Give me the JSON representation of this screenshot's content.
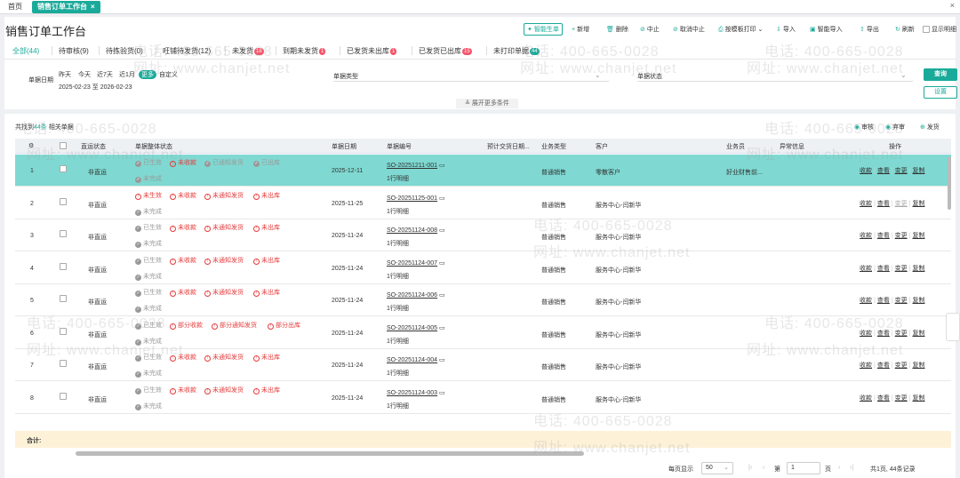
{
  "topbar": {
    "home_tab": "首页",
    "active_tab": "销售订单工作台",
    "close": "×",
    "close_window": "×"
  },
  "header": {
    "title": "销售订单工作台",
    "toolbar": [
      {
        "label": "智能生单",
        "icon": "sparkle-icon"
      },
      {
        "label": "新增",
        "icon": "plus-icon"
      },
      {
        "label": "删除",
        "icon": "trash-icon"
      },
      {
        "label": "中止",
        "icon": "stop-icon"
      },
      {
        "label": "取消中止",
        "icon": "undo-icon"
      },
      {
        "label": "按模板打印",
        "icon": "print-icon"
      },
      {
        "label": "导入",
        "icon": "import-icon"
      },
      {
        "label": "智能导入",
        "icon": "smart-import-icon"
      },
      {
        "label": "导出",
        "icon": "export-icon"
      },
      {
        "label": "刷新",
        "icon": "refresh-icon"
      }
    ],
    "show_detail": "显示明细"
  },
  "tabs": [
    {
      "label": "全部(44)",
      "badge": ""
    },
    {
      "label": "待审核(9)",
      "badge": ""
    },
    {
      "label": "待拣验货(0)",
      "badge": ""
    },
    {
      "label": "旺铺待发货(12)",
      "badge": ""
    },
    {
      "label": "未发货",
      "badge": "18"
    },
    {
      "label": "到期未发货",
      "badge": "1"
    },
    {
      "label": "已发货未出库",
      "badge": "1"
    },
    {
      "label": "已发货已出库",
      "badge": "15"
    },
    {
      "label": "未打印单据",
      "badge": "44"
    }
  ],
  "filters": {
    "date_label": "单据日期",
    "quick_dates": [
      "昨天",
      "今天",
      "近7天",
      "近1月",
      "更多",
      "自定义"
    ],
    "date_range": "2025-02-23 至 2026-02-23",
    "type_label": "单据类型",
    "status_label": "单据状态",
    "query": "查询",
    "settings": "设置",
    "expand": "展开更多条件"
  },
  "grid": {
    "found_prefix": "共找到",
    "found_count": "44条",
    "found_suffix": "相关单据",
    "actions": [
      "审核",
      "弃审",
      "发货"
    ],
    "headers": [
      "直运状态",
      "单据整体状态",
      "单据日期",
      "单据编号",
      "预计交货日期...",
      "业务类型",
      "客户",
      "业务员",
      "异常信息",
      "操作"
    ],
    "rows": [
      {
        "no": "1",
        "direct": "非直运",
        "statuses": [
          [
            "gray",
            "已生效"
          ],
          [
            "red",
            "未收款"
          ],
          [
            "gray",
            "已通知发货"
          ],
          [
            "gray",
            "已出库"
          ]
        ],
        "status2": "未完成",
        "date": "2025-12-11",
        "order": "SO-20251211-001",
        "detail": "1行明细",
        "biz": "普通销售",
        "customer": "零散客户",
        "sales": "好业财售前..."
      },
      {
        "no": "2",
        "direct": "非直运",
        "statuses": [
          [
            "red",
            "未生效"
          ],
          [
            "red",
            "未收款"
          ],
          [
            "red",
            "未通知发货"
          ],
          [
            "red",
            "未出库"
          ]
        ],
        "status2": "未完成",
        "date": "2025-11-25",
        "order": "SO-20251125-001",
        "detail": "1行明细",
        "biz": "普通销售",
        "customer": "服务中心-闫新华",
        "sales": ""
      },
      {
        "no": "3",
        "direct": "非直运",
        "statuses": [
          [
            "gray",
            "已生效"
          ],
          [
            "red",
            "未收款"
          ],
          [
            "red",
            "未通知发货"
          ],
          [
            "red",
            "未出库"
          ]
        ],
        "status2": "未完成",
        "date": "2025-11-24",
        "order": "SO-20251124-008",
        "detail": "1行明细",
        "biz": "普通销售",
        "customer": "服务中心-闫新华",
        "sales": ""
      },
      {
        "no": "4",
        "direct": "非直运",
        "statuses": [
          [
            "gray",
            "已生效"
          ],
          [
            "red",
            "未收款"
          ],
          [
            "red",
            "未通知发货"
          ],
          [
            "red",
            "未出库"
          ]
        ],
        "status2": "未完成",
        "date": "2025-11-24",
        "order": "SO-20251124-007",
        "detail": "1行明细",
        "biz": "普通销售",
        "customer": "服务中心-闫新华",
        "sales": ""
      },
      {
        "no": "5",
        "direct": "非直运",
        "statuses": [
          [
            "gray",
            "已生效"
          ],
          [
            "red",
            "未收款"
          ],
          [
            "red",
            "未通知发货"
          ],
          [
            "red",
            "未出库"
          ]
        ],
        "status2": "未完成",
        "date": "2025-11-24",
        "order": "SO-20251124-006",
        "detail": "1行明细",
        "biz": "普通销售",
        "customer": "服务中心-闫新华",
        "sales": ""
      },
      {
        "no": "6",
        "direct": "非直运",
        "statuses": [
          [
            "gray",
            "已生效"
          ],
          [
            "red",
            "部分收款"
          ],
          [
            "red",
            "部分通知发货"
          ],
          [
            "red",
            "部分出库"
          ]
        ],
        "status2": "未完成",
        "date": "2025-11-24",
        "order": "SO-20251124-005",
        "detail": "1行明细",
        "biz": "普通销售",
        "customer": "服务中心-闫新华",
        "sales": ""
      },
      {
        "no": "7",
        "direct": "非直运",
        "statuses": [
          [
            "gray",
            "已生效"
          ],
          [
            "red",
            "未收款"
          ],
          [
            "red",
            "未通知发货"
          ],
          [
            "red",
            "未出库"
          ]
        ],
        "status2": "未完成",
        "date": "2025-11-24",
        "order": "SO-20251124-004",
        "detail": "1行明细",
        "biz": "普通销售",
        "customer": "服务中心-闫新华",
        "sales": ""
      },
      {
        "no": "8",
        "direct": "非直运",
        "statuses": [
          [
            "gray",
            "已生效"
          ],
          [
            "red",
            "未收款"
          ],
          [
            "red",
            "未通知发货"
          ],
          [
            "red",
            "未出库"
          ]
        ],
        "status2": "未完成",
        "date": "2025-11-24",
        "order": "SO-20251124-003",
        "detail": "1行明细",
        "biz": "普通销售",
        "customer": "服务中心-闫新华",
        "sales": ""
      }
    ],
    "ops": [
      "收款",
      "查看",
      "变更",
      "复制"
    ],
    "total": "合计:"
  },
  "pager": {
    "per_page_label": "每页显示",
    "per_page": "50",
    "page_prefix": "第",
    "page": "1",
    "page_suffix": "页",
    "summary": "共1页, 44条记录"
  },
  "watermark": {
    "phone": "电话: 400-665-0028",
    "site": "网址: www.chanjet.net"
  },
  "colors": {
    "accent": "#1aaa9a",
    "selected_row": "#7fd9d2",
    "danger": "#e43c3c"
  }
}
